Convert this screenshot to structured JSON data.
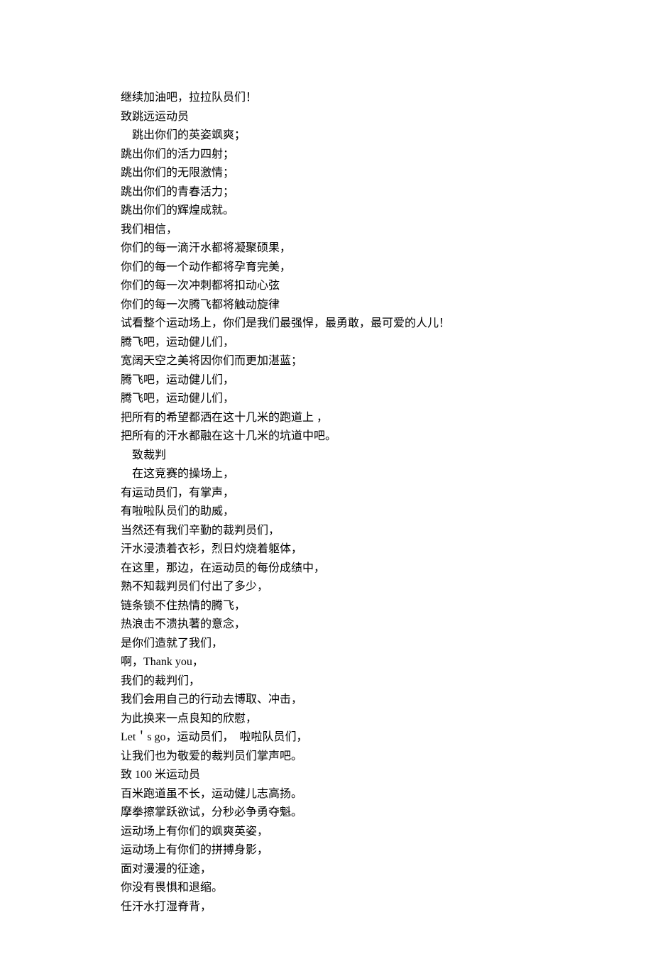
{
  "lines": [
    {
      "text": "继续加油吧，拉拉队员们！",
      "indent": false
    },
    {
      "text": "致跳远运动员",
      "indent": false
    },
    {
      "text": "跳出你们的英姿飒爽；",
      "indent": true
    },
    {
      "text": "跳出你们的活力四射；",
      "indent": false
    },
    {
      "text": "跳出你们的无限激情；",
      "indent": false
    },
    {
      "text": "跳出你们的青春活力；",
      "indent": false
    },
    {
      "text": "跳出你们的辉煌成就。",
      "indent": false
    },
    {
      "text": "我们相信，",
      "indent": false
    },
    {
      "text": "你们的每一滴汗水都将凝聚硕果，",
      "indent": false
    },
    {
      "text": "你们的每一个动作都将孕育完美，",
      "indent": false
    },
    {
      "text": "你们的每一次冲刺都将扣动心弦",
      "indent": false
    },
    {
      "text": "你们的每一次腾飞都将触动旋律",
      "indent": false
    },
    {
      "text": "试看整个运动场上，你们是我们最强悍，最勇敢，最可爱的人儿！",
      "indent": false
    },
    {
      "text": "腾飞吧，运动健儿们，",
      "indent": false
    },
    {
      "text": "宽阔天空之美将因你们而更加湛蓝；",
      "indent": false
    },
    {
      "text": "腾飞吧，运动健儿们，",
      "indent": false
    },
    {
      "text": "腾飞吧，运动健儿们，",
      "indent": false
    },
    {
      "text": "把所有的希望都洒在这十几米的跑道上 ，",
      "indent": false
    },
    {
      "text": "把所有的汗水都融在这十几米的坑道中吧。",
      "indent": false
    },
    {
      "text": "致裁判",
      "indent": true
    },
    {
      "text": "在这竞赛的操场上，",
      "indent": true
    },
    {
      "text": "有运动员们，有掌声，",
      "indent": false
    },
    {
      "text": "有啦啦队员们的助威，",
      "indent": false
    },
    {
      "text": "当然还有我们辛勤的裁判员们，",
      "indent": false
    },
    {
      "text": "汗水浸渍着衣衫，烈日灼烧着躯体，",
      "indent": false
    },
    {
      "text": "在这里，那边，在运动员的每份成绩中，",
      "indent": false
    },
    {
      "text": "熟不知裁判员们付出了多少，",
      "indent": false
    },
    {
      "text": "链条锁不住热情的腾飞，",
      "indent": false
    },
    {
      "text": "热浪击不溃执著的意念，",
      "indent": false
    },
    {
      "text": "是你们造就了我们，",
      "indent": false
    },
    {
      "text": "啊，Thank you，",
      "indent": false
    },
    {
      "text": "我们的裁判们，",
      "indent": false
    },
    {
      "text": "我们会用自己的行动去博取、冲击，",
      "indent": false
    },
    {
      "text": "为此换来一点良知的欣慰，",
      "indent": false
    },
    {
      "text": "Let＇s go，运动员们，  啦啦队员们，",
      "indent": false
    },
    {
      "text": "让我们也为敬爱的裁判员们掌声吧。",
      "indent": false
    },
    {
      "text": "致 100 米运动员",
      "indent": false
    },
    {
      "text": "百米跑道虽不长，运动健儿志高扬。",
      "indent": false
    },
    {
      "text": "摩拳擦掌跃欲试，分秒必争勇夺魁。",
      "indent": false
    },
    {
      "text": "运动场上有你们的飒爽英姿，",
      "indent": false
    },
    {
      "text": "运动场上有你们的拼搏身影，",
      "indent": false
    },
    {
      "text": "面对漫漫的征途，",
      "indent": false
    },
    {
      "text": "你没有畏惧和退缩。",
      "indent": false
    },
    {
      "text": "任汗水打湿脊背，",
      "indent": false
    }
  ]
}
